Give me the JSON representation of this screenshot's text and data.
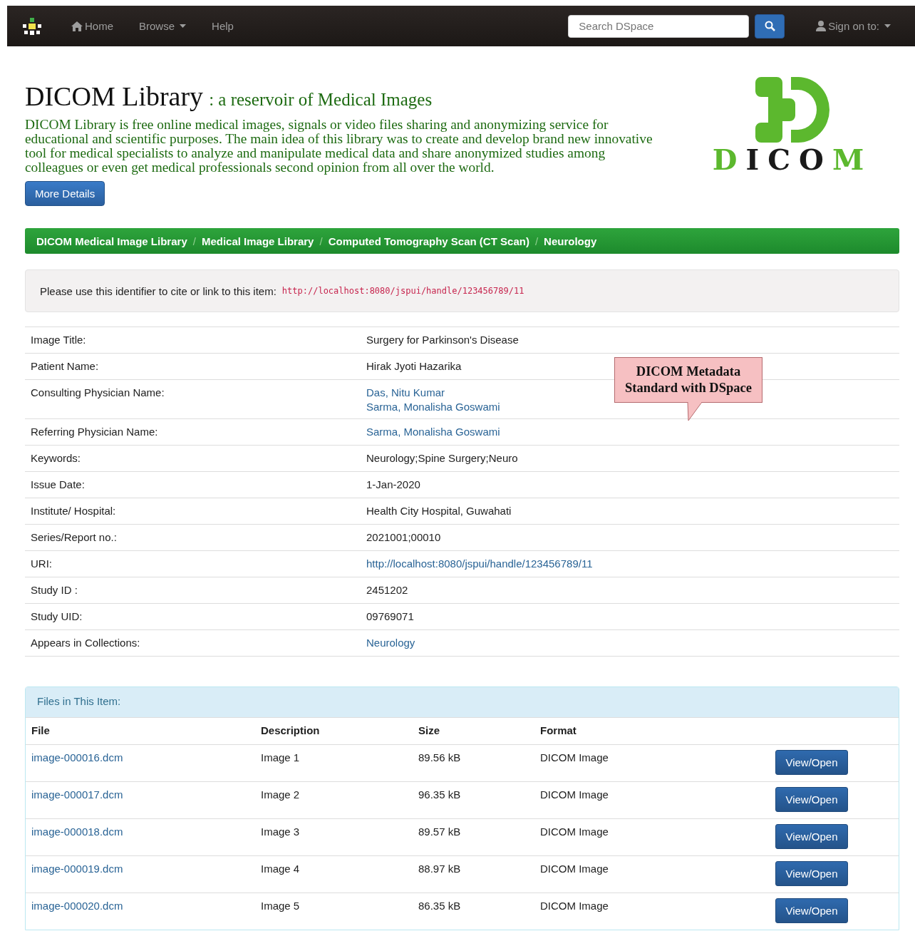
{
  "navbar": {
    "items": [
      {
        "label": "Home",
        "kind": "home"
      },
      {
        "label": "Browse",
        "kind": "dropdown"
      },
      {
        "label": "Help",
        "kind": "plain"
      }
    ],
    "search": {
      "placeholder": "Search DSpace"
    },
    "signin": "Sign on to:"
  },
  "header": {
    "title": "DICOM Library",
    "subtitle": ": a reservoir of Medical Images",
    "description": "DICOM Library is free online medical images, signals or video files sharing and anonymizing service for educational and scientific purposes. The main idea of this library was to create and develop brand new innovative tool for medical specialists to analyze and manipulate medical data and share anonymized studies among colleagues or even get medical professionals second opinion from all over the world.",
    "button": "More Details",
    "logo_letters": [
      {
        "char": "D",
        "color": "#5cb82e"
      },
      {
        "char": "I",
        "color": "#1a1a1a"
      },
      {
        "char": "C",
        "color": "#1a1a1a"
      },
      {
        "char": "O",
        "color": "#1a1a1a"
      },
      {
        "char": "M",
        "color": "#5cb82e"
      }
    ]
  },
  "breadcrumb": {
    "separator": "/",
    "items": [
      "DICOM Medical Image Library",
      "Medical Image Library",
      "Computed Tomography Scan (CT Scan)",
      "Neurology"
    ]
  },
  "identifier": {
    "label": "Please use this identifier to cite or link to this item:",
    "url": "http://localhost:8080/jspui/handle/123456789/11"
  },
  "metadata": [
    {
      "label": "Image Title:",
      "values": [
        {
          "text": "Surgery for Parkinson's Disease",
          "link": false
        }
      ]
    },
    {
      "label": "Patient Name:",
      "values": [
        {
          "text": "Hirak Jyoti Hazarika",
          "link": false
        }
      ]
    },
    {
      "label": "Consulting Physician Name:",
      "values": [
        {
          "text": "Das, Nitu Kumar",
          "link": true
        },
        {
          "text": "Sarma, Monalisha Goswami",
          "link": true
        }
      ]
    },
    {
      "label": "Referring Physician Name:",
      "values": [
        {
          "text": "Sarma, Monalisha Goswami",
          "link": true
        }
      ]
    },
    {
      "label": "Keywords:",
      "values": [
        {
          "text": "Neurology;Spine Surgery;Neuro",
          "link": false
        }
      ]
    },
    {
      "label": "Issue Date:",
      "values": [
        {
          "text": "1-Jan-2020",
          "link": false
        }
      ]
    },
    {
      "label": "Institute/ Hospital:",
      "values": [
        {
          "text": "Health City Hospital, Guwahati",
          "link": false
        }
      ]
    },
    {
      "label": "Series/Report no.:",
      "values": [
        {
          "text": "2021001;00010",
          "link": false
        }
      ]
    },
    {
      "label": "URI:",
      "values": [
        {
          "text": "http://localhost:8080/jspui/handle/123456789/11",
          "link": true
        }
      ]
    },
    {
      "label": "Study ID :",
      "values": [
        {
          "text": "2451202",
          "link": false
        }
      ]
    },
    {
      "label": "Study UID:",
      "values": [
        {
          "text": "09769071",
          "link": false
        }
      ]
    },
    {
      "label": "Appears in Collections:",
      "values": [
        {
          "text": "Neurology",
          "link": true
        }
      ]
    }
  ],
  "callout": "DICOM Metadata Standard with DSpace",
  "files": {
    "heading": "Files in This Item:",
    "columns": [
      "File",
      "Description",
      "Size",
      "Format"
    ],
    "rows": [
      {
        "file": "image-000016.dcm",
        "description": "Image 1",
        "size": "89.56 kB",
        "format": "DICOM Image",
        "button": "View/Open"
      },
      {
        "file": "image-000017.dcm",
        "description": "Image 2",
        "size": "96.35 kB",
        "format": "DICOM Image",
        "button": "View/Open"
      },
      {
        "file": "image-000018.dcm",
        "description": "Image 3",
        "size": "89.57 kB",
        "format": "DICOM Image",
        "button": "View/Open"
      },
      {
        "file": "image-000019.dcm",
        "description": "Image 4",
        "size": "88.97 kB",
        "format": "DICOM Image",
        "button": "View/Open"
      },
      {
        "file": "image-000020.dcm",
        "description": "Image 5",
        "size": "86.35 kB",
        "format": "DICOM Image",
        "button": "View/Open"
      }
    ]
  }
}
